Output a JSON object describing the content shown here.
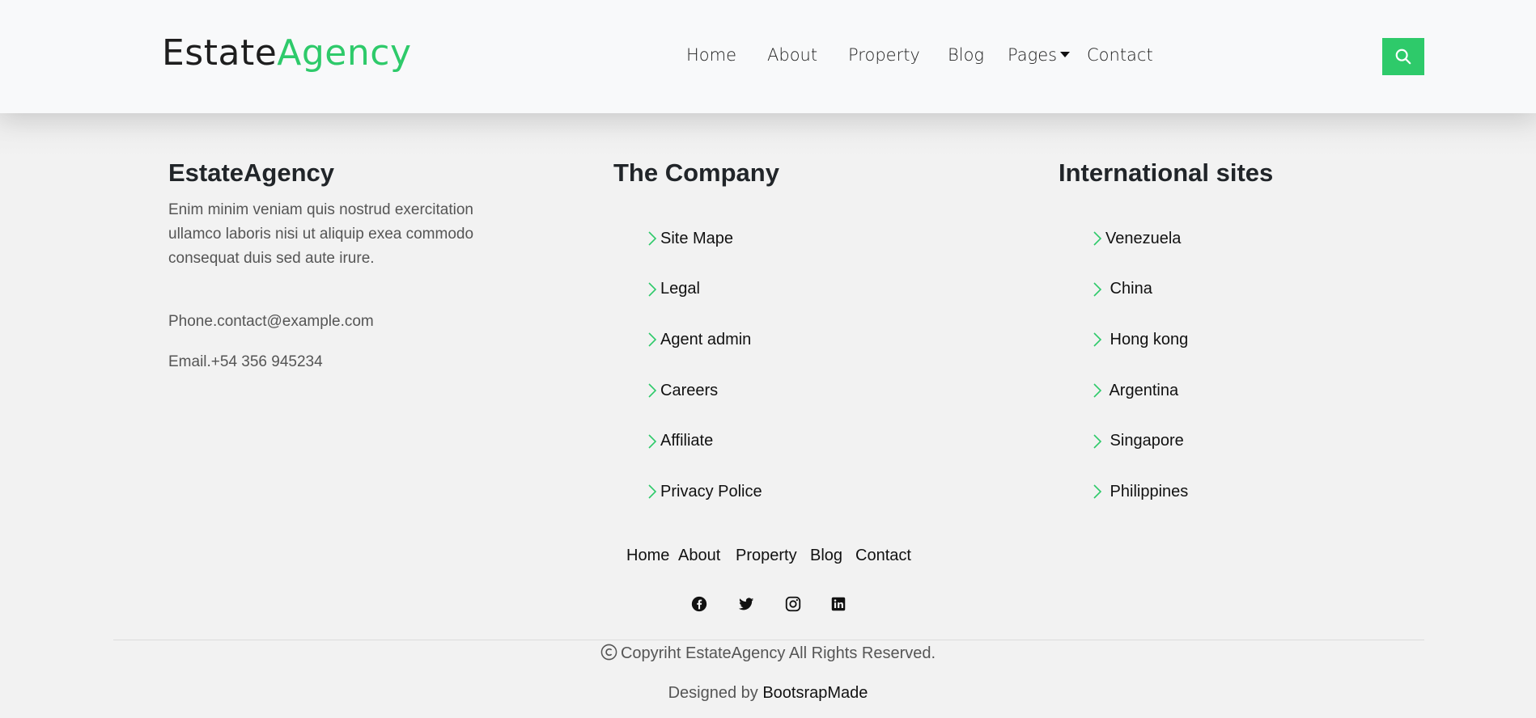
{
  "header": {
    "brand_part1": "Estate",
    "brand_part2": "Agency",
    "nav": [
      "Home",
      "About",
      "Property",
      "Blog",
      "Pages",
      "Contact"
    ],
    "search_icon": "search-icon"
  },
  "colors": {
    "accent": "#2eca6a",
    "header_bg": "#f8f9fa",
    "page_bg": "#f2f2f2"
  },
  "footer": {
    "about": {
      "title": "EstateAgency",
      "text": "Enim minim veniam quis nostrud exercitation ullamco laboris nisi ut aliquip exea commodo consequat duis sed aute irure.",
      "phone": "Phone.contact@example.com",
      "email": "Email.+54 356 945234"
    },
    "company": {
      "title": "The Company",
      "links": [
        "Site Mape",
        "Legal",
        "Agent admin",
        "Careers",
        "Affiliate",
        "Privacy Police"
      ]
    },
    "international": {
      "title": "International sites",
      "links": [
        "Venezuela",
        " China",
        " Hong kong",
        " Argentina",
        " Singapore",
        " Philippines"
      ]
    },
    "bottom_nav": [
      "Home",
      "About",
      "Property",
      "Blog",
      "Contact"
    ],
    "socials": [
      "facebook-icon",
      "twitter-icon",
      "instagram-icon",
      "linkedin-icon"
    ],
    "copyright": "Copyriht EstateAgency All Rights Reserved.",
    "designed_prefix": "Designed by ",
    "designed_link": "BootsrapMade"
  }
}
